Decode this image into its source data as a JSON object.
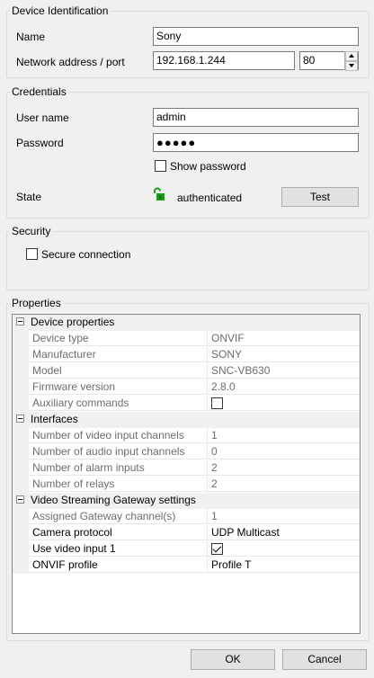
{
  "device_identification": {
    "title": "Device Identification",
    "name_label": "Name",
    "name_value": "Sony",
    "network_label": "Network address / port",
    "address_value": "192.168.1.244",
    "port_value": "80"
  },
  "credentials": {
    "title": "Credentials",
    "username_label": "User name",
    "username_value": "admin",
    "password_label": "Password",
    "password_masked": "●●●●●",
    "show_password_label": "Show password",
    "state_label": "State",
    "state_value": "authenticated",
    "test_button": "Test"
  },
  "security": {
    "title": "Security",
    "secure_connection_label": "Secure connection"
  },
  "properties": {
    "title": "Properties",
    "categories": [
      {
        "name": "Device properties",
        "items": [
          {
            "name": "Device type",
            "value": "ONVIF"
          },
          {
            "name": "Manufacturer",
            "value": "SONY"
          },
          {
            "name": "Model",
            "value": "SNC-VB630"
          },
          {
            "name": "Firmware version",
            "value": "2.8.0"
          },
          {
            "name": "Auxiliary commands",
            "value": ""
          }
        ]
      },
      {
        "name": "Interfaces",
        "items": [
          {
            "name": "Number of video input channels",
            "value": "1"
          },
          {
            "name": "Number of audio input channels",
            "value": "0"
          },
          {
            "name": "Number of alarm inputs",
            "value": "2"
          },
          {
            "name": "Number of relays",
            "value": "2"
          }
        ]
      },
      {
        "name": "Video Streaming Gateway settings",
        "items": [
          {
            "name": "Assigned Gateway channel(s)",
            "value": "1"
          },
          {
            "name": "Camera protocol",
            "value": "UDP Multicast"
          },
          {
            "name": "Use video input 1",
            "value": ""
          },
          {
            "name": "ONVIF profile",
            "value": "Profile T"
          }
        ]
      }
    ]
  },
  "footer": {
    "ok_button": "OK",
    "cancel_button": "Cancel"
  },
  "colors": {
    "window_bg": "#f0f0f0",
    "lock_green": "#1a9e1a"
  },
  "icons": {
    "lock": "unlocked-padlock-icon",
    "expander": "collapse-minus-icon",
    "spinner": "spin-up-down-icon"
  }
}
